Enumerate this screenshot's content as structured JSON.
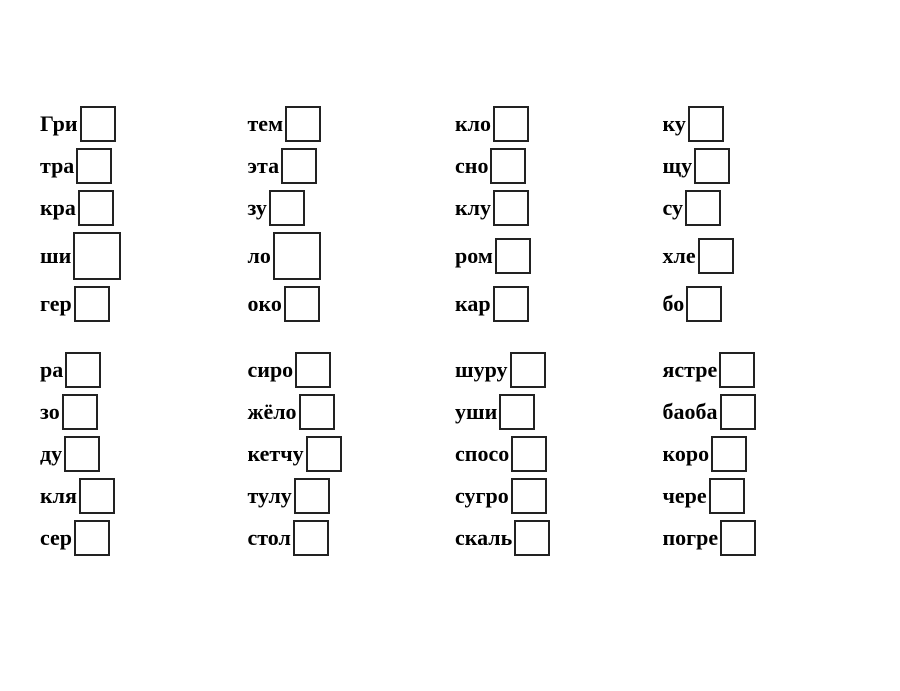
{
  "section1": {
    "items": [
      {
        "prefix": "Гри",
        "large": false
      },
      {
        "prefix": "тем",
        "large": false
      },
      {
        "prefix": "кло",
        "large": false
      },
      {
        "prefix": "ку",
        "large": false
      },
      {
        "prefix": "тра",
        "large": false
      },
      {
        "prefix": "эта",
        "large": false
      },
      {
        "prefix": "сно",
        "large": false
      },
      {
        "prefix": "щу",
        "large": false
      },
      {
        "prefix": "кра",
        "large": false
      },
      {
        "prefix": "зу",
        "large": false
      },
      {
        "prefix": "клу",
        "large": false
      },
      {
        "prefix": "су",
        "large": false
      },
      {
        "prefix": "ши",
        "large": true
      },
      {
        "prefix": "ло",
        "large": true
      },
      {
        "prefix": "ром",
        "large": false
      },
      {
        "prefix": "хле",
        "large": false
      },
      {
        "prefix": "гер",
        "large": false
      },
      {
        "prefix": "око",
        "large": false
      },
      {
        "prefix": "кар",
        "large": false
      },
      {
        "prefix": "бо",
        "large": false
      }
    ]
  },
  "section2": {
    "items": [
      {
        "prefix": "ра",
        "large": false
      },
      {
        "prefix": "сиро",
        "large": false
      },
      {
        "prefix": "шуру",
        "large": false
      },
      {
        "prefix": "ястре",
        "large": false
      },
      {
        "prefix": "зо",
        "large": false
      },
      {
        "prefix": "жёло",
        "large": false
      },
      {
        "prefix": "уши",
        "large": false
      },
      {
        "prefix": "баоба",
        "large": false
      },
      {
        "prefix": "ду",
        "large": false
      },
      {
        "prefix": "кетчу",
        "large": false
      },
      {
        "prefix": "спосо",
        "large": false
      },
      {
        "prefix": "коро",
        "large": false
      },
      {
        "prefix": "кля",
        "large": false
      },
      {
        "prefix": "тулу",
        "large": false
      },
      {
        "prefix": "сугро",
        "large": false
      },
      {
        "prefix": "чере",
        "large": false
      },
      {
        "prefix": "сер",
        "large": false
      },
      {
        "prefix": "стол",
        "large": false
      },
      {
        "prefix": "скаль",
        "large": false
      },
      {
        "prefix": "погре",
        "large": false
      }
    ]
  }
}
